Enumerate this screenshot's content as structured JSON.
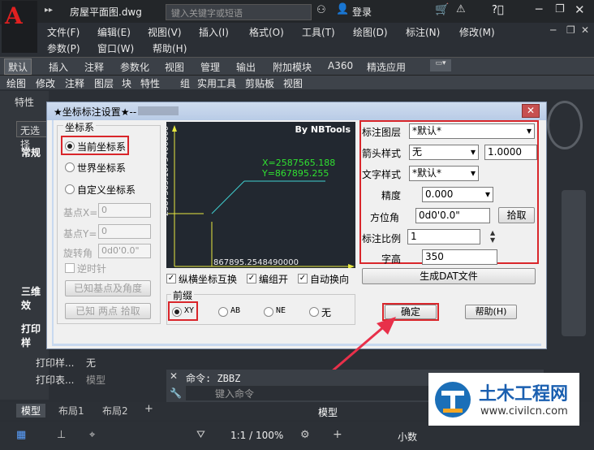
{
  "app": {
    "file_title": "房屋平面图.dwg",
    "search_placeholder": "键入关键字或短语",
    "login": "登录"
  },
  "menu": [
    "文件(F)",
    "编辑(E)",
    "视图(V)",
    "插入(I)",
    "格式(O)",
    "工具(T)",
    "绘图(D)",
    "标注(N)",
    "修改(M)",
    "参数(P)",
    "窗口(W)",
    "帮助(H)"
  ],
  "ribbon_tabs": [
    "默认",
    "插入",
    "注释",
    "参数化",
    "视图",
    "管理",
    "输出",
    "附加模块",
    "A360",
    "精选应用"
  ],
  "panels": [
    "绘图",
    "修改",
    "注释",
    "图层",
    "块",
    "特性",
    "组",
    "实用工具",
    "剪贴板",
    "视图"
  ],
  "left_palette": {
    "title": "特性",
    "no_selection": "无选择",
    "sections": [
      "常规",
      "三维效",
      "打印样"
    ],
    "rows": [
      {
        "label": "打印样...",
        "value": "无"
      },
      {
        "label": "打印表...",
        "value": "模型"
      }
    ]
  },
  "dialog": {
    "title": "★坐标标注设置★--",
    "close": "✕",
    "coord_group": "坐标系",
    "coord_options": [
      "当前坐标系",
      "世界坐标系",
      "自定义坐标系"
    ],
    "base_x_label": "基点X=",
    "base_x_value": "0",
    "base_y_label": "基点Y=",
    "base_y_value": "0",
    "rotate_label": "旋转角",
    "rotate_value": "0d0'0.0\"",
    "ccw_label": "逆时针",
    "known_base_btn": "已知基点及角度",
    "known_two_btn": "已知 两点 拾取",
    "preview": {
      "brand": "By NBTools",
      "x_text": "X=2587565.188",
      "y_text": "Y=867895.255",
      "vert_text": "2587565.1875400000",
      "horiz_text": "867895.2548490000"
    },
    "checks": [
      "纵横坐标互换",
      "编组开",
      "自动换向"
    ],
    "prefix_label": "前缀",
    "prefix_options": [
      "XY",
      "AB",
      "NE",
      "无"
    ],
    "layer_label": "标注图层",
    "layer_value": "*默认*",
    "arrow_label": "箭头样式",
    "arrow_value": "无",
    "arrow_size": "1.0000",
    "text_style_label": "文字样式",
    "text_style_value": "*默认*",
    "precision_label": "精度",
    "precision_value": "0.000",
    "angle_label": "方位角",
    "angle_value": "0d0'0.0\"",
    "pick_btn": "拾取",
    "scale_label": "标注比例",
    "scale_value": "1",
    "height_label": "字高",
    "height_value": "350",
    "gen_btn": "生成DAT文件",
    "ok_btn": "确定",
    "help_btn": "帮助(H)"
  },
  "command": {
    "last": "命令: ZBBZ",
    "placeholder": "键入命令"
  },
  "layout_tabs": [
    "模型",
    "布局1",
    "布局2"
  ],
  "status": {
    "model": "模型",
    "scale": "1:1 / 100%",
    "units": "小数"
  },
  "watermark": {
    "name": "土木工程网",
    "url": "www.civilcn.com"
  }
}
